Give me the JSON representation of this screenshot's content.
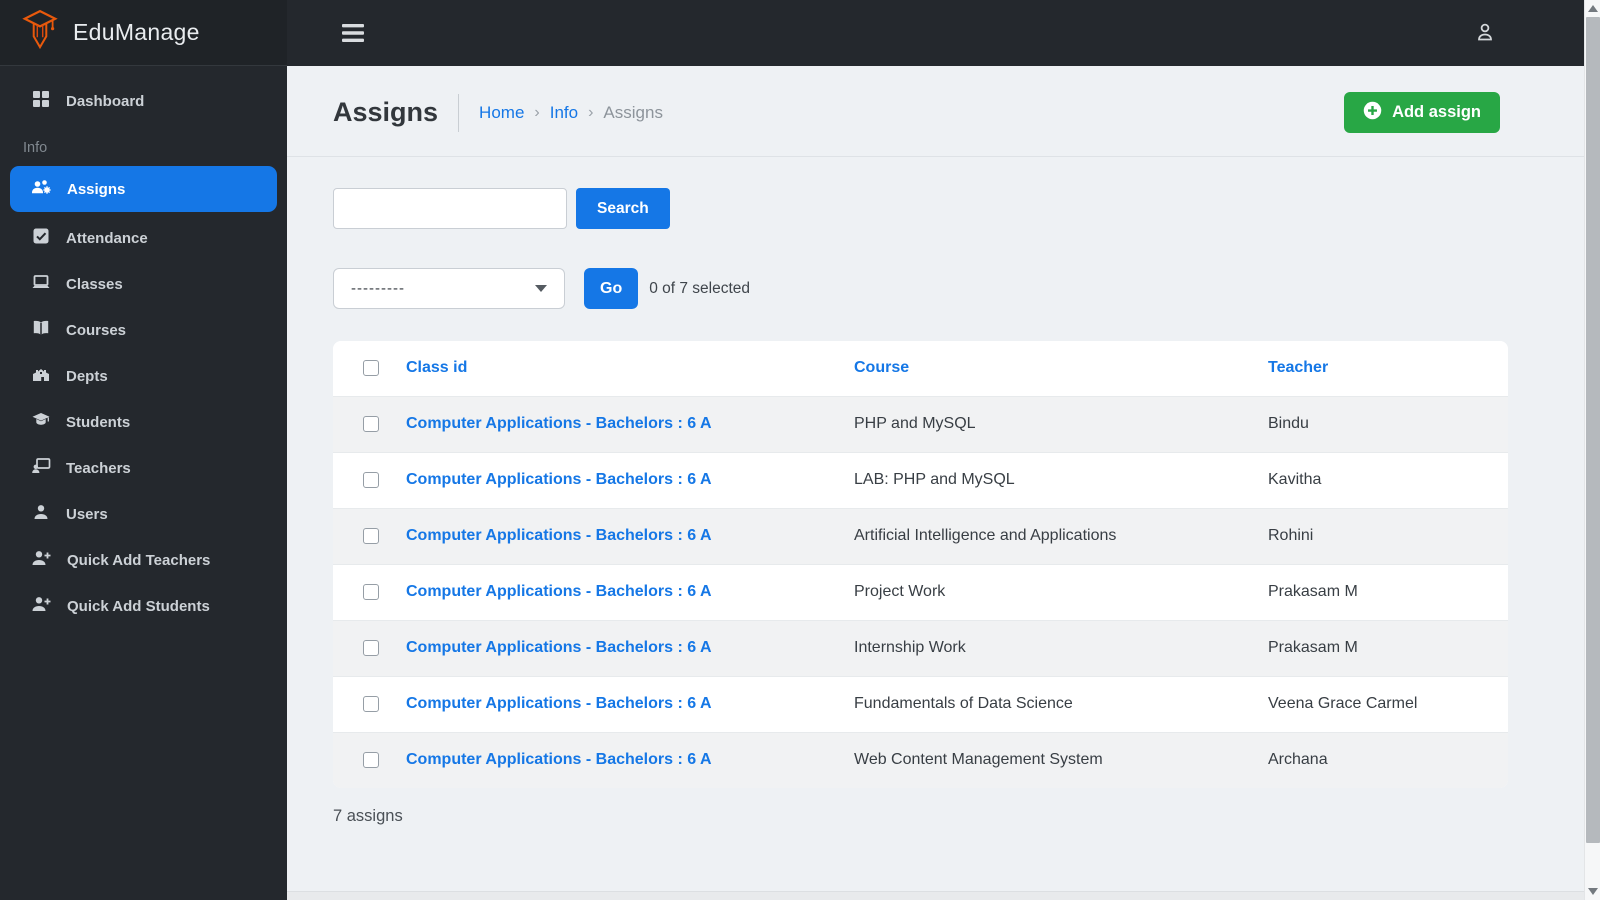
{
  "colors": {
    "accent_blue": "#1577e6",
    "success_green": "#28a745",
    "sidebar_bg": "#24282d",
    "logo_orange": "#e8590c",
    "stripe_gray": "#f1f2f3"
  },
  "brand": {
    "name": "EduManage"
  },
  "sidebar": {
    "dashboard_label": "Dashboard",
    "section_label": "Info",
    "items": [
      {
        "label": "Assigns",
        "icon": "users-gear-icon",
        "active": true
      },
      {
        "label": "Attendance",
        "icon": "check-square-icon",
        "active": false
      },
      {
        "label": "Classes",
        "icon": "laptop-icon",
        "active": false
      },
      {
        "label": "Courses",
        "icon": "book-open-icon",
        "active": false
      },
      {
        "label": "Depts",
        "icon": "school-building-icon",
        "active": false
      },
      {
        "label": "Students",
        "icon": "graduation-cap-icon",
        "active": false
      },
      {
        "label": "Teachers",
        "icon": "teacher-board-icon",
        "active": false
      },
      {
        "label": "Users",
        "icon": "user-icon",
        "active": false
      },
      {
        "label": "Quick Add Teachers",
        "icon": "user-plus-icon",
        "active": false
      },
      {
        "label": "Quick Add Students",
        "icon": "user-plus-icon",
        "active": false
      }
    ]
  },
  "header": {
    "title": "Assigns",
    "separator": "›",
    "breadcrumb": [
      {
        "label": "Home"
      },
      {
        "label": "Info"
      },
      {
        "label": "Assigns"
      }
    ],
    "add_button_label": "Add assign"
  },
  "filters": {
    "search_value": "",
    "search_button_label": "Search",
    "action_select_value": "---------",
    "go_button_label": "Go",
    "selection_status": "0 of 7 selected"
  },
  "table": {
    "columns": {
      "class_id": "Class id",
      "course": "Course",
      "teacher": "Teacher"
    },
    "rows": [
      {
        "class_id": "Computer Applications - Bachelors : 6 A",
        "course": "PHP and MySQL",
        "teacher": "Bindu"
      },
      {
        "class_id": "Computer Applications - Bachelors : 6 A",
        "course": "LAB: PHP and MySQL",
        "teacher": "Kavitha"
      },
      {
        "class_id": "Computer Applications - Bachelors : 6 A",
        "course": "Artificial Intelligence and Applications",
        "teacher": "Rohini"
      },
      {
        "class_id": "Computer Applications - Bachelors : 6 A",
        "course": "Project Work",
        "teacher": "Prakasam M"
      },
      {
        "class_id": "Computer Applications - Bachelors : 6 A",
        "course": "Internship Work",
        "teacher": "Prakasam M"
      },
      {
        "class_id": "Computer Applications - Bachelors : 6 A",
        "course": "Fundamentals of Data Science",
        "teacher": "Veena Grace Carmel"
      },
      {
        "class_id": "Computer Applications - Bachelors : 6 A",
        "course": "Web Content Management System",
        "teacher": "Archana"
      }
    ],
    "footer": "7 assigns"
  }
}
